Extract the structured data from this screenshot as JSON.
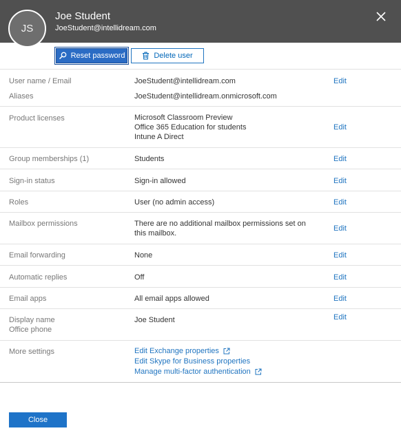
{
  "user": {
    "initials": "JS",
    "name": "Joe Student",
    "email": "JoeStudent@intellidream.com"
  },
  "actions": {
    "reset_password": "Reset password",
    "delete_user": "Delete user"
  },
  "edit_label": "Edit",
  "rows": {
    "username": {
      "label": "User name / Email",
      "value": "JoeStudent@intellidream.com"
    },
    "aliases": {
      "label": "Aliases",
      "value": "JoeStudent@intellidream.onmicrosoft.com"
    },
    "licenses": {
      "label": "Product licenses",
      "values": [
        "Microsoft Classroom Preview",
        "Office 365 Education for students",
        "Intune A Direct"
      ]
    },
    "groups": {
      "label": "Group memberships (1)",
      "value": "Students"
    },
    "signin": {
      "label": "Sign-in status",
      "value": "Sign-in allowed"
    },
    "roles": {
      "label": "Roles",
      "value": "User (no admin access)"
    },
    "mailbox": {
      "label": "Mailbox permissions",
      "values": [
        "There are no additional mailbox permissions set on",
        "this mailbox."
      ]
    },
    "forwarding": {
      "label": "Email forwarding",
      "value": "None"
    },
    "replies": {
      "label": "Automatic replies",
      "value": "Off"
    },
    "apps": {
      "label": "Email apps",
      "value": "All email apps allowed"
    },
    "display": {
      "labels": [
        "Display name",
        "Office phone"
      ],
      "value": "Joe Student"
    },
    "more": {
      "label": "More settings",
      "links": [
        "Edit Exchange properties",
        "Edit Skype for Business properties",
        "Manage multi-factor authentication"
      ]
    }
  },
  "footer": {
    "close_label": "Close"
  },
  "colors": {
    "header_bg": "#505050",
    "accent": "#1f74c0",
    "primary_button": "#2b6cc4"
  },
  "icons": {
    "close": "close-icon",
    "reset": "key-search-icon",
    "delete": "trash-icon",
    "external": "external-link-icon"
  }
}
